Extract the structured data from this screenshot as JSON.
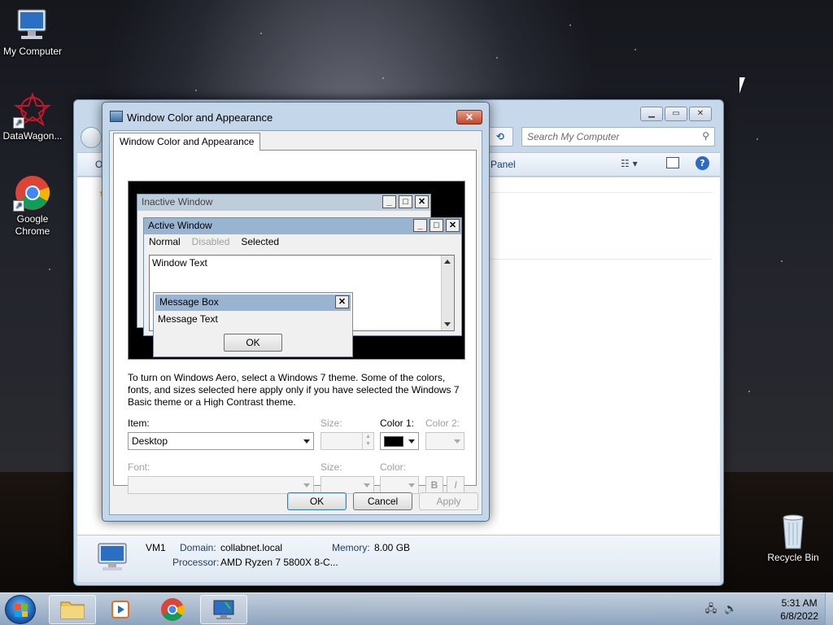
{
  "desktop": {
    "icons": [
      {
        "label": "My Computer"
      },
      {
        "label": "DataWagon..."
      },
      {
        "label": "Google Chrome"
      },
      {
        "label": "Recycle Bin"
      }
    ]
  },
  "explorer": {
    "search_placeholder": "Search My Computer",
    "toolbar_left": "O",
    "toolbar_panel": "Panel",
    "details": {
      "name": "VM1",
      "domain_label": "Domain:",
      "domain_value": "collabnet.local",
      "memory_label": "Memory:",
      "memory_value": "8.00 GB",
      "processor_label": "Processor:",
      "processor_value": "AMD Ryzen 7 5800X 8-C..."
    }
  },
  "dialog": {
    "title": "Window Color and Appearance",
    "close_glyph": "✕",
    "tab_label": "Window Color and Appearance",
    "preview": {
      "inactive_title": "Inactive Window",
      "active_title": "Active Window",
      "menu_normal": "Normal",
      "menu_disabled": "Disabled",
      "menu_selected": "Selected",
      "window_text": "Window Text",
      "msgbox_title": "Message Box",
      "msgbox_text": "Message Text",
      "msgbox_ok": "OK"
    },
    "description": "To turn on Windows Aero, select a Windows 7 theme.  Some of the colors, fonts, and sizes selected here apply only if you have selected the Windows 7 Basic theme or a High Contrast theme.",
    "item_label": "Item:",
    "item_value": "Desktop",
    "size_label": "Size:",
    "color1_label": "Color 1:",
    "color1_value": "#000000",
    "color2_label": "Color 2:",
    "font_label": "Font:",
    "font_size_label": "Size:",
    "font_color_label": "Color:",
    "bold_label": "B",
    "italic_label": "I",
    "ok_label": "OK",
    "cancel_label": "Cancel",
    "apply_label": "Apply"
  },
  "taskbar": {
    "time": "5:31 AM",
    "date": "6/8/2022"
  },
  "colors": {
    "title_active": "#99b4d1",
    "title_inactive": "#bfcddb",
    "taskbar": "#b9cde2"
  }
}
